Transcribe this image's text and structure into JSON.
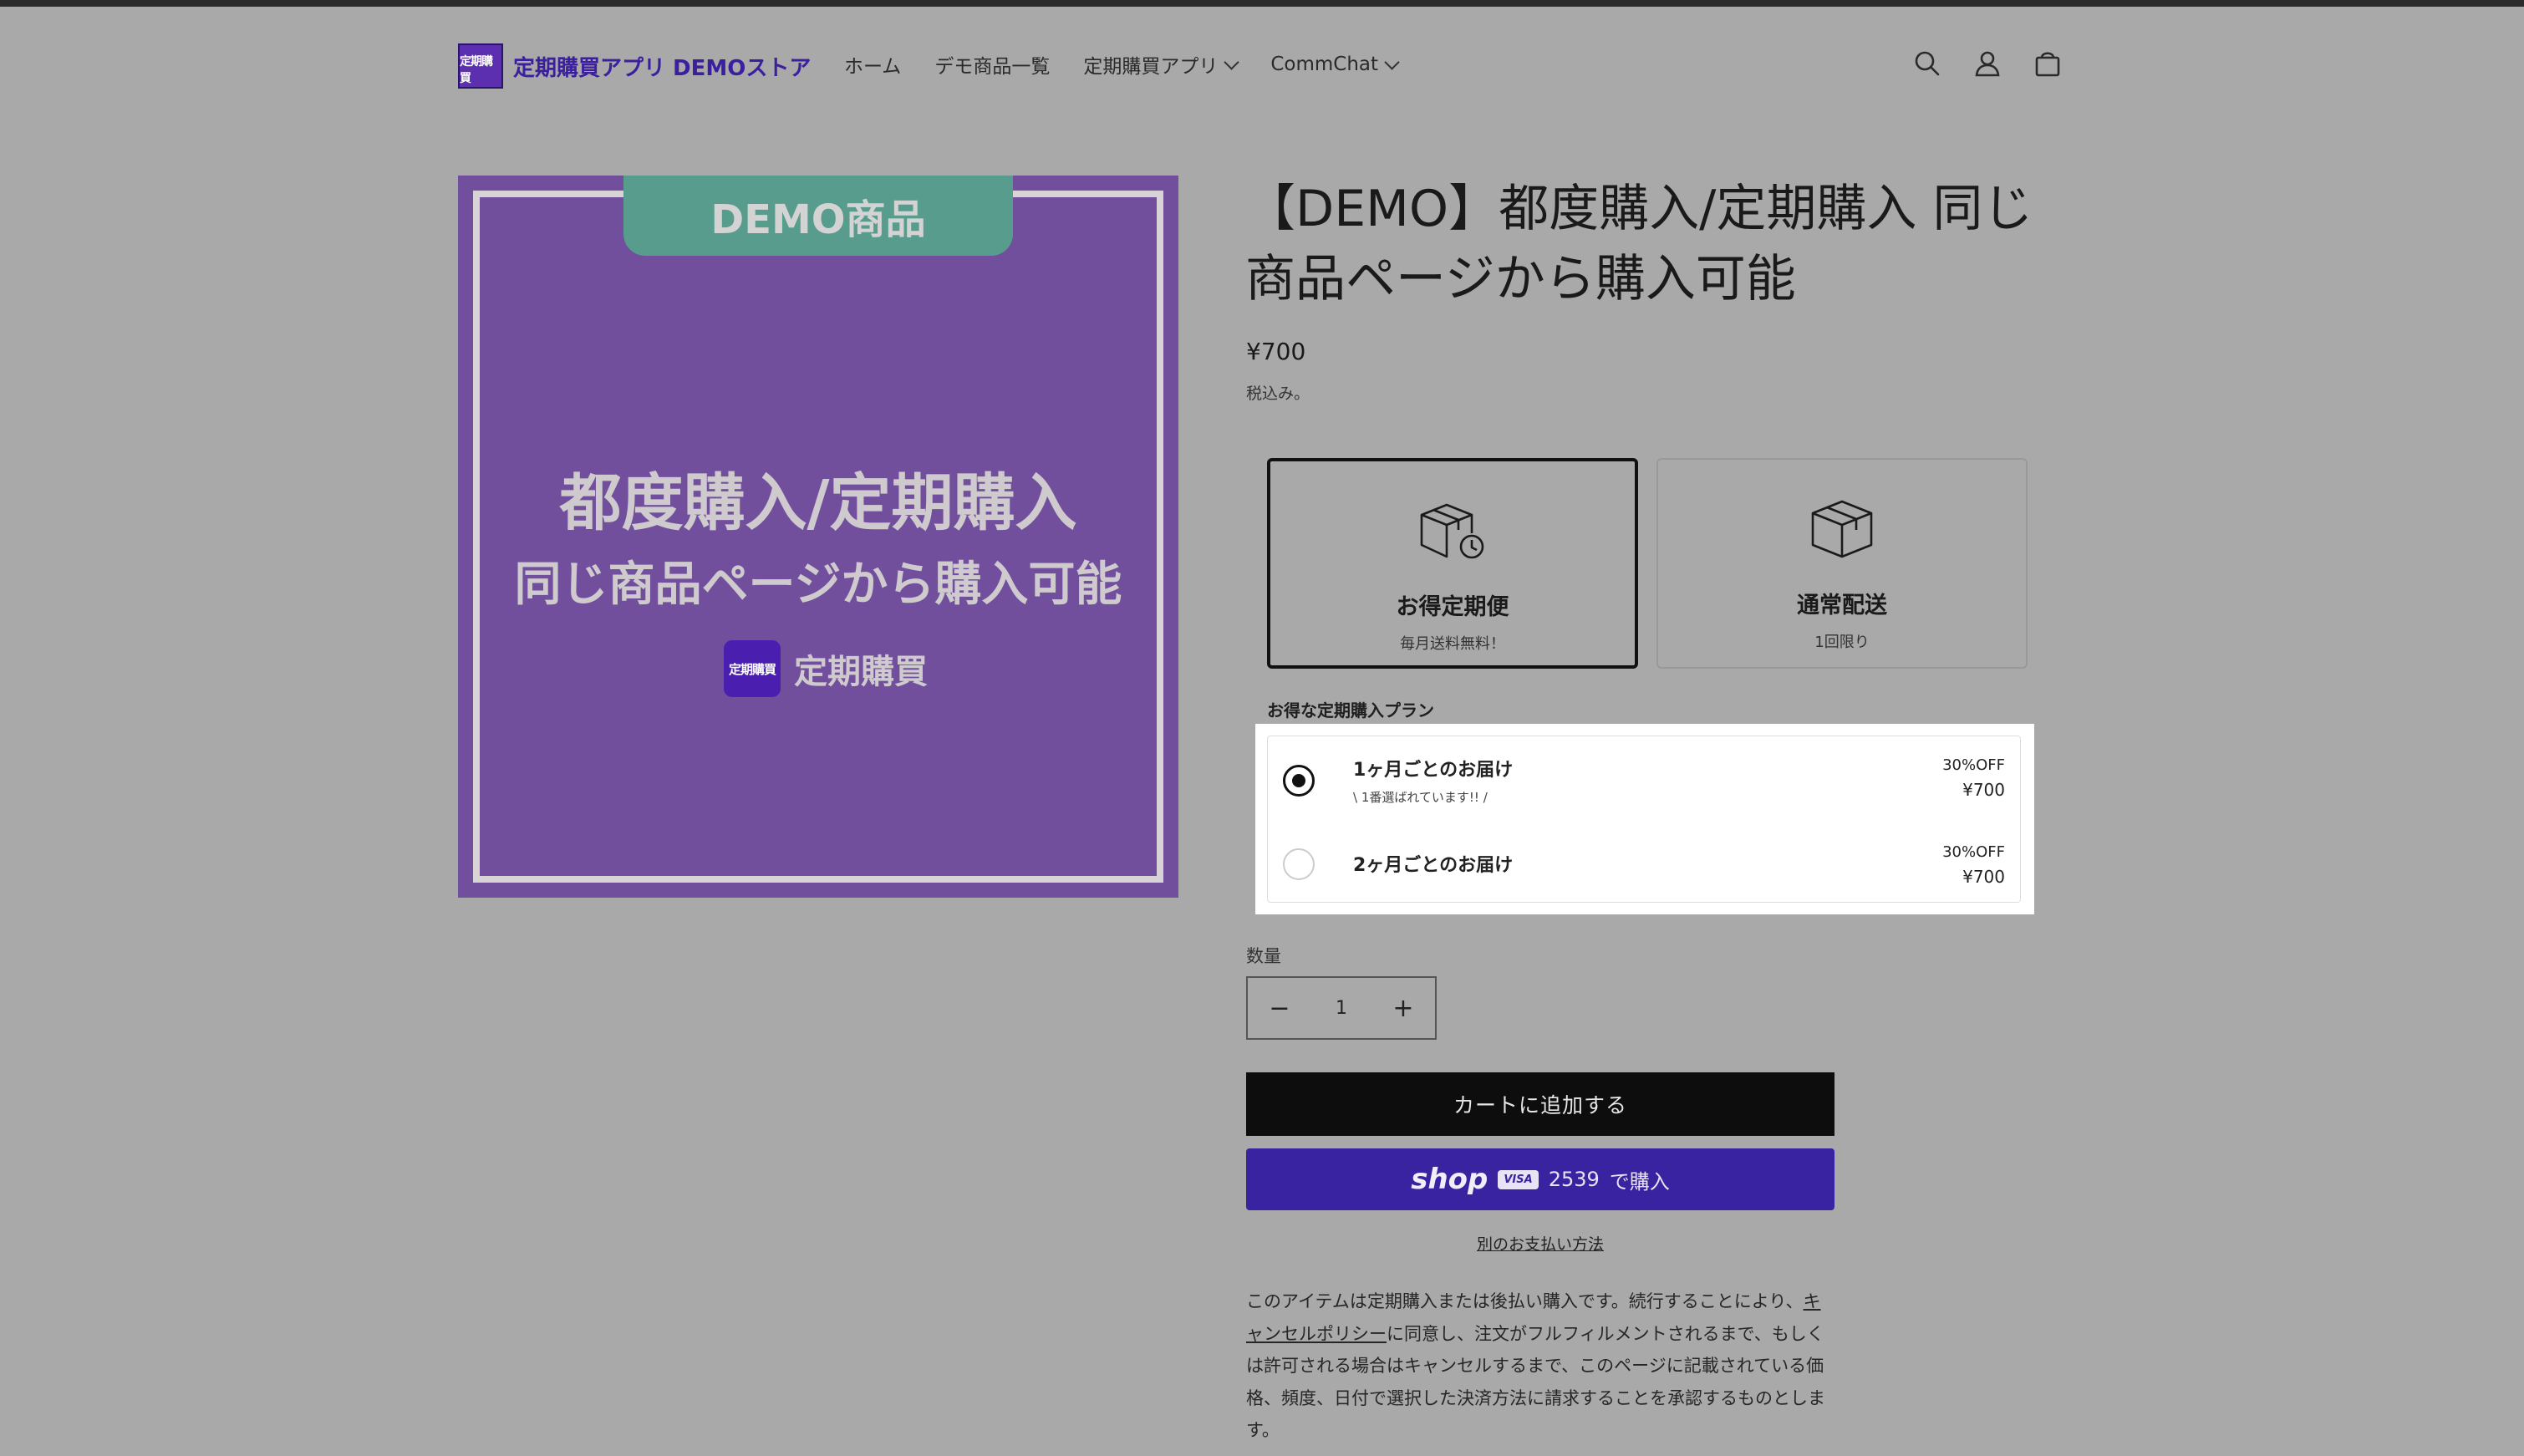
{
  "header": {
    "logo_mark": "定期購買",
    "store_name": "定期購買アプリ DEMOストア",
    "nav": [
      {
        "label": "ホーム"
      },
      {
        "label": "デモ商品一覧"
      },
      {
        "label": "定期購買アプリ"
      },
      {
        "label": "CommChat"
      }
    ],
    "icons": [
      "search-icon",
      "account-icon",
      "cart-icon"
    ]
  },
  "media": {
    "tag": "DEMO商品",
    "line1": "都度購入/定期購入",
    "line2": "同じ商品ページから購入可能",
    "brand_mark": "定期購買",
    "brand_text": "定期購買"
  },
  "product": {
    "title": "【DEMO】都度購入/定期購入 同じ商品ページから購入可能",
    "price": "¥700",
    "tax_note": "税込み。"
  },
  "purchase_options": [
    {
      "title": "お得定期便",
      "subtitle": "毎月送料無料！",
      "selected": true,
      "icon": "box-clock-icon"
    },
    {
      "title": "通常配送",
      "subtitle": "1回限り",
      "selected": false,
      "icon": "box-icon"
    }
  ],
  "plans": {
    "label": "お得な定期購入プラン",
    "items": [
      {
        "name": "1ヶ月ごとのお届け",
        "note": "\\ 1番選ばれています!! /",
        "discount": "30%OFF",
        "price": "¥700",
        "selected": true
      },
      {
        "name": "2ヶ月ごとのお届け",
        "note": "",
        "discount": "30%OFF",
        "price": "¥700",
        "selected": false
      }
    ]
  },
  "quantity": {
    "label": "数量",
    "value": "1",
    "minus": "−",
    "plus": "+"
  },
  "buttons": {
    "add_to_cart": "カートに追加する",
    "shop_word": "shop",
    "shop_card_brand": "VISA",
    "shop_card_last4": "2539",
    "shop_buy": "で購入",
    "alt_payment": "別のお支払い方法"
  },
  "description": {
    "before": "このアイテムは定期購入または後払い購入です。続行することにより、",
    "link": "キャンセルポリシー",
    "after": "に同意し、注文がフルフィルメントされるまで、もしくは許可される場合はキャンセルするまで、このページに記載されている価格、頻度、日付で選択した決済方法に請求することを承認するものとします。"
  },
  "colors": {
    "background": "#a9a9a9",
    "brand": "#3b1f9e",
    "media_bg": "#714f9c",
    "media_tag": "#579c8d",
    "shop_pay": "#3a23a0",
    "cart_button": "#0d0d0d"
  }
}
